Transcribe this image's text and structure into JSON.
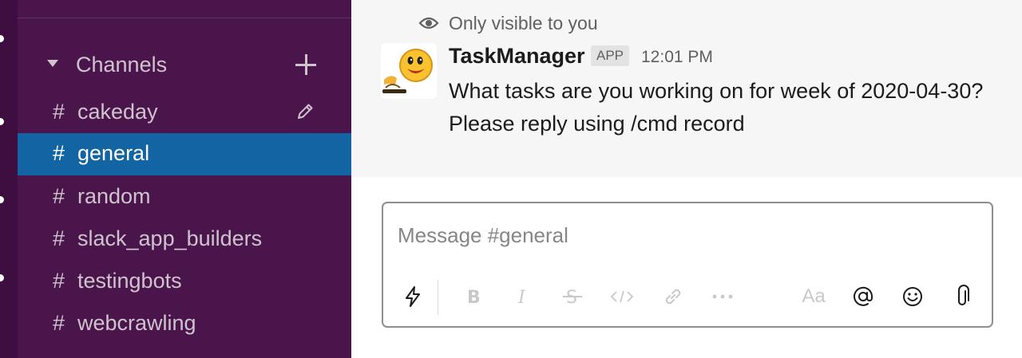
{
  "sidebar": {
    "section": {
      "label": "Channels",
      "icon": "triangle-down-icon",
      "add_icon": "plus-icon"
    },
    "channels": [
      {
        "name": "cakeday",
        "prefix": "#"
      },
      {
        "name": "general",
        "prefix": "#",
        "active": true
      },
      {
        "name": "random",
        "prefix": "#"
      },
      {
        "name": "slack_app_builders",
        "prefix": "#"
      },
      {
        "name": "testingbots",
        "prefix": "#"
      },
      {
        "name": "webcrawling",
        "prefix": "#"
      }
    ],
    "edit_icon": "pencil-icon"
  },
  "message": {
    "visibility": "Only visible to you",
    "sender": "TaskManager",
    "badge": "APP",
    "time": "12:01 PM",
    "lines": [
      "What tasks are you working on for week of 2020-04-30?",
      "Please reply using /cmd record"
    ]
  },
  "composer": {
    "placeholder": "Message #general",
    "format_label": "Aa",
    "tools": [
      "shortcuts-icon",
      "bold-icon",
      "italic-icon",
      "strikethrough-icon",
      "code-icon",
      "link-icon",
      "more-icon",
      "format-icon",
      "mention-icon",
      "emoji-icon",
      "attach-icon"
    ]
  },
  "colors": {
    "sidebar_bg": "#4a154b",
    "rail_bg": "#3f0e40",
    "active_channel": "#1264a3",
    "message_bg": "#f6f6f6"
  }
}
